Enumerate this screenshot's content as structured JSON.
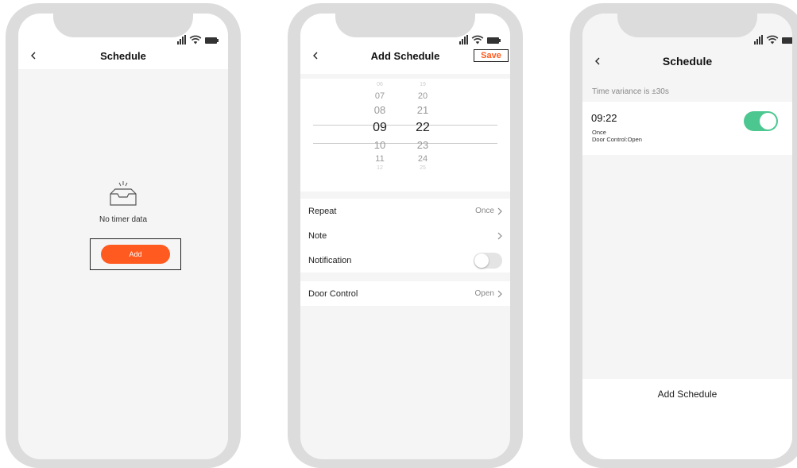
{
  "colors": {
    "accent": "#ff5a1f",
    "toggle_on": "#4cc790",
    "frame": "#dcdcdc"
  },
  "phone1": {
    "title": "Schedule",
    "empty_icon": "empty-inbox-icon",
    "empty_text": "No timer data",
    "add_label": "Add"
  },
  "phone2": {
    "title": "Add Schedule",
    "save_label": "Save",
    "picker": {
      "hours": [
        "06",
        "07",
        "08",
        "09",
        "10",
        "11",
        "12"
      ],
      "minutes": [
        "19",
        "20",
        "21",
        "22",
        "23",
        "24",
        "25"
      ],
      "selected_hour": "09",
      "selected_minute": "22"
    },
    "rows": {
      "repeat_label": "Repeat",
      "repeat_value": "Once",
      "note_label": "Note",
      "notification_label": "Notification",
      "door_control_label": "Door Control",
      "door_control_value": "Open"
    }
  },
  "phone3": {
    "title": "Schedule",
    "variance": "Time variance is  ±30s",
    "item": {
      "time": "09:22",
      "repeat": "Once",
      "action": "Door Control:Open"
    },
    "add_schedule_label": "Add Schedule"
  }
}
